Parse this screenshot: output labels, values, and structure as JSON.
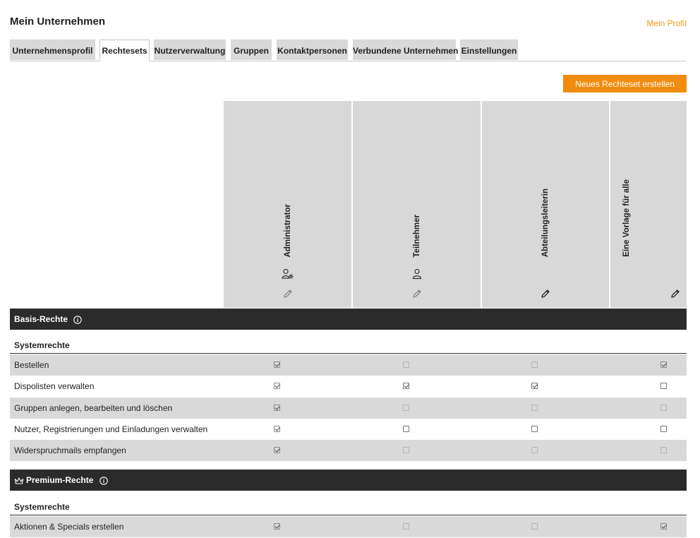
{
  "header": {
    "title": "Mein Unternehmen",
    "profile_link": "Mein Profil"
  },
  "tabs": [
    {
      "label": "Unternehmensprofil",
      "active": false
    },
    {
      "label": "Rechtesets",
      "active": true
    },
    {
      "label": "Nutzerverwaltung",
      "active": false
    },
    {
      "label": "Gruppen",
      "active": false
    },
    {
      "label": "Kontaktpersonen",
      "active": false
    },
    {
      "label": "Verbundene Unternehmen",
      "active": false
    },
    {
      "label": "Einstellungen",
      "active": false
    }
  ],
  "actions": {
    "new_ruleset": "Neues Rechteset erstellen"
  },
  "roles": [
    {
      "name": "Administrator",
      "icon": "user-gear-icon",
      "edit_enabled": false
    },
    {
      "name": "Teilnehmer",
      "icon": "user-icon",
      "edit_enabled": false
    },
    {
      "name": "Abteilungsleiterin",
      "icon": null,
      "edit_enabled": true
    },
    {
      "name": "Eine Vorlage für alle",
      "icon": null,
      "edit_enabled": true
    }
  ],
  "sections": {
    "basis": {
      "title": "Basis-Rechte",
      "group": "Systemrechte",
      "rows": [
        {
          "label": "Bestellen",
          "cells": [
            {
              "checked": true,
              "disabled": true
            },
            {
              "checked": false,
              "disabled": true
            },
            {
              "checked": false,
              "disabled": true
            },
            {
              "checked": true,
              "disabled": true
            }
          ]
        },
        {
          "label": "Dispolisten verwalten",
          "cells": [
            {
              "checked": true,
              "disabled": true
            },
            {
              "checked": true,
              "disabled": false
            },
            {
              "checked": true,
              "disabled": false
            },
            {
              "checked": false,
              "disabled": false
            }
          ]
        },
        {
          "label": "Gruppen anlegen, bearbeiten und löschen",
          "cells": [
            {
              "checked": true,
              "disabled": true
            },
            {
              "checked": false,
              "disabled": true
            },
            {
              "checked": false,
              "disabled": true
            },
            {
              "checked": false,
              "disabled": true
            }
          ]
        },
        {
          "label": "Nutzer, Registrierungen und Einladungen verwalten",
          "cells": [
            {
              "checked": true,
              "disabled": true
            },
            {
              "checked": false,
              "disabled": false
            },
            {
              "checked": false,
              "disabled": false
            },
            {
              "checked": false,
              "disabled": false
            }
          ]
        },
        {
          "label": "Widerspruchmails empfangen",
          "cells": [
            {
              "checked": true,
              "disabled": true
            },
            {
              "checked": false,
              "disabled": true
            },
            {
              "checked": false,
              "disabled": true
            },
            {
              "checked": false,
              "disabled": true
            }
          ]
        }
      ]
    },
    "premium": {
      "title": "Premium-Rechte",
      "group": "Systemrechte",
      "rows": [
        {
          "label": "Aktionen & Specials erstellen",
          "cells": [
            {
              "checked": true,
              "disabled": true
            },
            {
              "checked": false,
              "disabled": true
            },
            {
              "checked": false,
              "disabled": true
            },
            {
              "checked": true,
              "disabled": true
            }
          ]
        }
      ]
    }
  },
  "colors": {
    "accent": "#f28c0f",
    "link": "#f39a1b",
    "section_bar": "#2b2b2b",
    "row_shade": "#d9d9d9",
    "role_column": "#d8d8d8"
  }
}
